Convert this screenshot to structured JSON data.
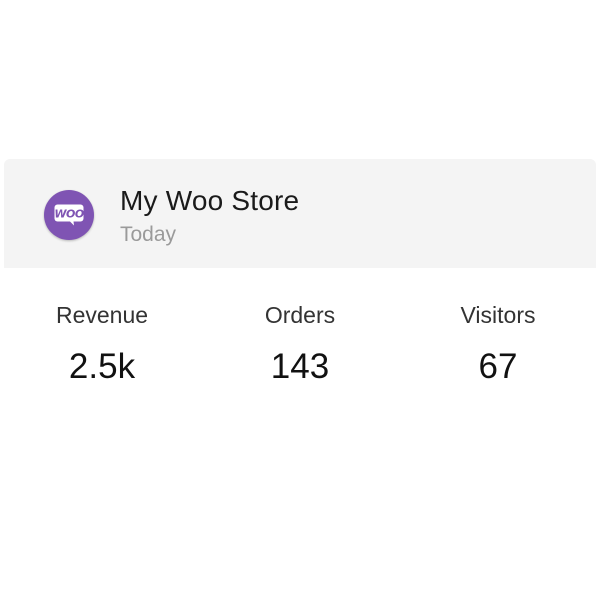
{
  "widget": {
    "brand_color": "#7f54b3",
    "icon": "woocommerce-logo-icon",
    "logo_text": "WOO",
    "store_name": "My Woo Store",
    "period": "Today",
    "stats": [
      {
        "label": "Revenue",
        "value": "2.5k"
      },
      {
        "label": "Orders",
        "value": "143"
      },
      {
        "label": "Visitors",
        "value": "67"
      }
    ]
  }
}
